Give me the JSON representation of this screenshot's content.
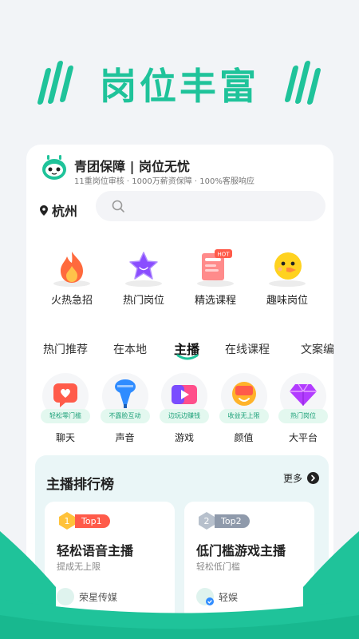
{
  "hero": {
    "title": "岗位丰富"
  },
  "brand": {
    "title": "青团保障 | 岗位无忧",
    "subtitle": "11重岗位审核 · 1000万薪资保障 · 100%客服响应"
  },
  "location": {
    "city": "杭州"
  },
  "quick_entries": [
    {
      "label": "火热急招",
      "icon": "flame-icon"
    },
    {
      "label": "热门岗位",
      "icon": "star-icon"
    },
    {
      "label": "精选课程",
      "icon": "course-hot-icon"
    },
    {
      "label": "趣味岗位",
      "icon": "chick-icon"
    }
  ],
  "tabs": [
    {
      "label": "热门推荐",
      "active": false
    },
    {
      "label": "在本地",
      "active": false
    },
    {
      "label": "主播",
      "active": true
    },
    {
      "label": "在线课程",
      "active": false
    },
    {
      "label": "文案编",
      "active": false
    }
  ],
  "categories": [
    {
      "badge": "轻松零门槛",
      "label": "聊天",
      "icon": "chat-heart-icon"
    },
    {
      "badge": "不露脸互动",
      "label": "声音",
      "icon": "microphone-icon"
    },
    {
      "badge": "边玩边赚钱",
      "label": "游戏",
      "icon": "game-icon"
    },
    {
      "badge": "收益无上限",
      "label": "颜值",
      "icon": "beauty-icon"
    },
    {
      "badge": "热门岗位",
      "label": "大平台",
      "icon": "diamond-icon"
    }
  ],
  "ranking": {
    "title": "主播排行榜",
    "more_label": "更多",
    "cards": [
      {
        "rank": "1",
        "badge": "Top1",
        "title": "轻松语音主播",
        "subtitle": "提成无上限",
        "company": "荣星传媒"
      },
      {
        "rank": "2",
        "badge": "Top2",
        "title": "低门槛游戏主播",
        "subtitle": "轻松低门槛",
        "company": "轻娱"
      }
    ]
  },
  "colors": {
    "brand": "#1fc39a",
    "top1": "#ff5b4a",
    "top2": "#8f9aab"
  }
}
